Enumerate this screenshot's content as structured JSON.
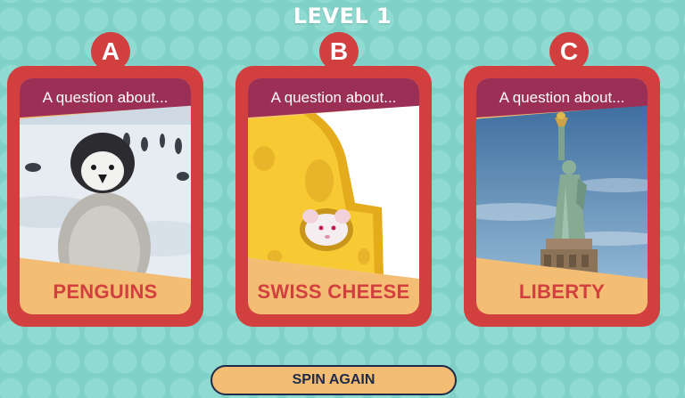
{
  "header": {
    "title": "LEVEL 1"
  },
  "cards": [
    {
      "letter": "A",
      "prompt": "A question about...",
      "topic": "PENGUINS"
    },
    {
      "letter": "B",
      "prompt": "A question about...",
      "topic": "SWISS CHEESE"
    },
    {
      "letter": "C",
      "prompt": "A question about...",
      "topic": "LIBERTY"
    }
  ],
  "footer": {
    "spin_label": "SPIN AGAIN"
  },
  "colors": {
    "background": "#7fd0c6",
    "card_red": "#d23f3f",
    "prompt_band": "#9b2f55",
    "label_band": "#f3bd73",
    "button_border": "#1e2b4a"
  }
}
